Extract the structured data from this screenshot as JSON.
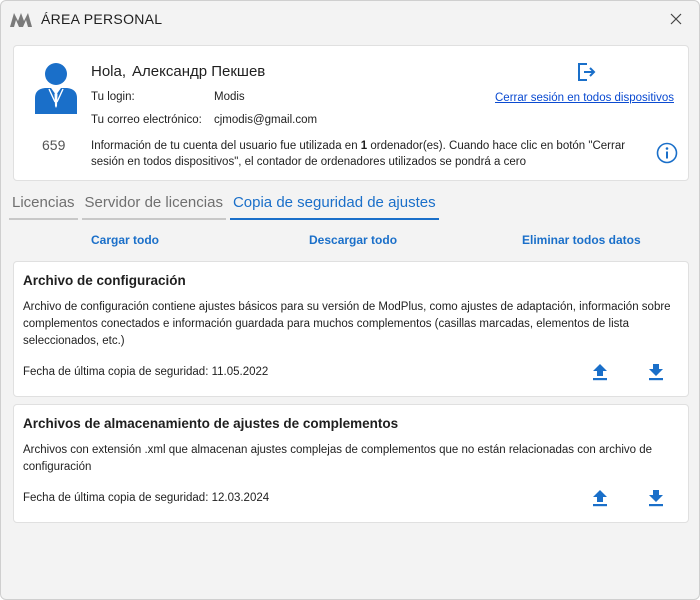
{
  "window": {
    "title": "ÁREA PERSONAL"
  },
  "profile": {
    "greeting": "Hola,",
    "user_name": "Александр Пекшев",
    "login_label": "Tu login:",
    "login_value": "Modis",
    "email_label": "Tu correo electrónico:",
    "email_value": "cjmodis@gmail.com",
    "device_count": "659",
    "info_text_before": "Información de tu cuenta del usuario fue utilizada en ",
    "info_text_count": "1",
    "info_text_after": " ordenador(es). Cuando hace clic en botón \"Cerrar sesión en todos dispositivos\", el contador de ordenadores utilizados se pondrá a cero",
    "logout_link": "Cerrar sesión en todos dispositivos"
  },
  "tabs": [
    {
      "label": "Licencias",
      "active": false
    },
    {
      "label": "Servidor de licencias",
      "active": false
    },
    {
      "label": "Copia de seguridad de ajustes",
      "active": true
    }
  ],
  "actions": {
    "load_all": "Cargar todo",
    "download_all": "Descargar todo",
    "delete_all": "Eliminar todos datos"
  },
  "sections": [
    {
      "title": "Archivo de configuración",
      "description": "Archivo de configuración contiene ajustes básicos para su versión de ModPlus, como ajustes de adaptación, información sobre complementos conectados e información guardada para muchos complementos (casillas marcadas, elementos de lista seleccionados, etc.)",
      "last_backup": "Fecha de última copia de seguridad: 11.05.2022"
    },
    {
      "title": "Archivos de almacenamiento de ajustes de complementos",
      "description": "Archivos con extensión .xml que almacenan ajustes complejas de complementos que no están relacionadas con archivo de configuración",
      "last_backup": "Fecha de última copia de seguridad: 12.03.2024"
    }
  ],
  "colors": {
    "accent": "#1a6fc9",
    "link": "#0a4ad1",
    "logo": "#7a7a7a"
  },
  "icons": {
    "logo": "modplus-logo-icon",
    "close": "close-icon",
    "avatar": "user-avatar-icon",
    "logout": "logout-icon",
    "info": "info-icon",
    "upload": "upload-icon",
    "download": "download-icon"
  }
}
